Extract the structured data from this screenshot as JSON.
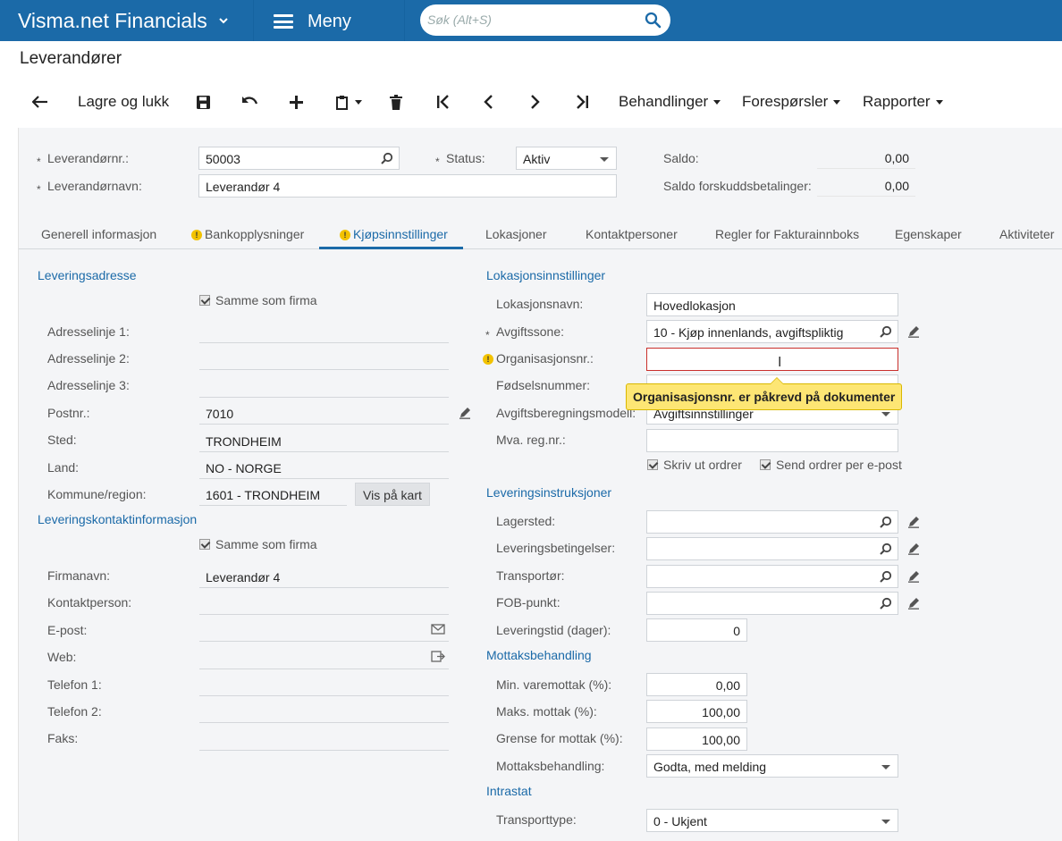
{
  "app": {
    "title": "Visma.net Financials",
    "menu_label": "Meny",
    "search_placeholder": "Søk (Alt+S)"
  },
  "page_title": "Leverandører",
  "toolbar": {
    "save_close": "Lagre og lukk",
    "processing": "Behandlinger",
    "inquiries": "Forespørsler",
    "reports": "Rapporter"
  },
  "header": {
    "vendor_id_label": "Leverandørnr.:",
    "vendor_id": "50003",
    "vendor_name_label": "Leverandørnavn:",
    "vendor_name": "Leverandør 4",
    "status_label": "Status:",
    "status": "Aktiv",
    "balance_label": "Saldo:",
    "balance": "0,00",
    "prepay_label": "Saldo forskuddsbetalinger:",
    "prepay": "0,00"
  },
  "tabs": [
    {
      "label": "Generell informasjon"
    },
    {
      "label": "Bankopplysninger"
    },
    {
      "label": "Kjøpsinnstillinger"
    },
    {
      "label": "Lokasjoner"
    },
    {
      "label": "Kontaktpersoner"
    },
    {
      "label": "Regler for Fakturainnboks"
    },
    {
      "label": "Egenskaper"
    },
    {
      "label": "Aktiviteter"
    }
  ],
  "delivery_address": {
    "section": "Leveringsadresse",
    "same_as_company": "Samme som firma",
    "addr1_label": "Adresselinje 1:",
    "addr2_label": "Adresselinje 2:",
    "addr3_label": "Adresselinje 3:",
    "postal_label": "Postnr.:",
    "postal": "7010",
    "city_label": "Sted:",
    "city": "TRONDHEIM",
    "country_label": "Land:",
    "country": "NO - NORGE",
    "county_label": "Kommune/region:",
    "county": "1601 - TRONDHEIM",
    "map_button": "Vis på kart"
  },
  "delivery_contact": {
    "section": "Leveringskontaktinformasjon",
    "same_as_company": "Samme som firma",
    "company_label": "Firmanavn:",
    "company": "Leverandør 4",
    "contact_label": "Kontaktperson:",
    "email_label": "E-post:",
    "web_label": "Web:",
    "phone1_label": "Telefon 1:",
    "phone2_label": "Telefon 2:",
    "fax_label": "Faks:"
  },
  "location_settings": {
    "section": "Lokasjonsinnstillinger",
    "loc_name_label": "Lokasjonsnavn:",
    "loc_name": "Hovedlokasjon",
    "tax_zone_label": "Avgiftssone:",
    "tax_zone": "10 - Kjøp innenlands, avgiftspliktig",
    "org_no_label": "Organisasjonsnr.:",
    "birth_no_label": "Fødselsnummer:",
    "tax_calc_label": "Avgiftsberegningsmodell:",
    "tax_calc": "Avgiftsinnstillinger",
    "vat_reg_label": "Mva. reg.nr.:",
    "print_orders": "Skriv ut ordrer",
    "email_orders": "Send ordrer per e-post",
    "tooltip": "Organisasjonsnr. er påkrevd på dokumenter"
  },
  "delivery_instructions": {
    "section": "Leveringsinstruksjoner",
    "warehouse_label": "Lagersted:",
    "terms_label": "Leveringsbetingelser:",
    "carrier_label": "Transportør:",
    "fob_label": "FOB-punkt:",
    "lead_time_label": "Leveringstid (dager):",
    "lead_time": "0"
  },
  "receipt": {
    "section": "Mottaksbehandling",
    "min_label": "Min. varemottak (%):",
    "min": "0,00",
    "max_label": "Maks. mottak (%):",
    "max": "100,00",
    "threshold_label": "Grense for mottak (%):",
    "threshold": "100,00",
    "action_label": "Mottaksbehandling:",
    "action": "Godta, med melding"
  },
  "intrastat": {
    "section": "Intrastat",
    "transport_label": "Transporttype:",
    "transport": "0 - Ukjent"
  }
}
